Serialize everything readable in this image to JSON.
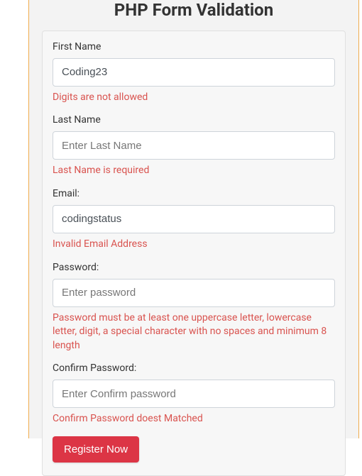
{
  "title": "PHP Form Validation",
  "fields": {
    "first_name": {
      "label": "First Name",
      "value": "Coding23",
      "placeholder": "",
      "error": "Digits are not allowed"
    },
    "last_name": {
      "label": "Last Name",
      "value": "",
      "placeholder": "Enter Last Name",
      "error": "Last Name is required"
    },
    "email": {
      "label": "Email:",
      "value": "codingstatus",
      "placeholder": "",
      "error": "Invalid Email Address"
    },
    "password": {
      "label": "Password:",
      "value": "",
      "placeholder": "Enter password",
      "error": "Password must be at least one uppercase letter, lowercase letter, digit, a special character with no spaces and minimum 8 length"
    },
    "confirm_password": {
      "label": "Confirm Password:",
      "value": "",
      "placeholder": "Enter Confirm password",
      "error": "Confirm Password doest Matched"
    }
  },
  "submit_label": "Register Now"
}
